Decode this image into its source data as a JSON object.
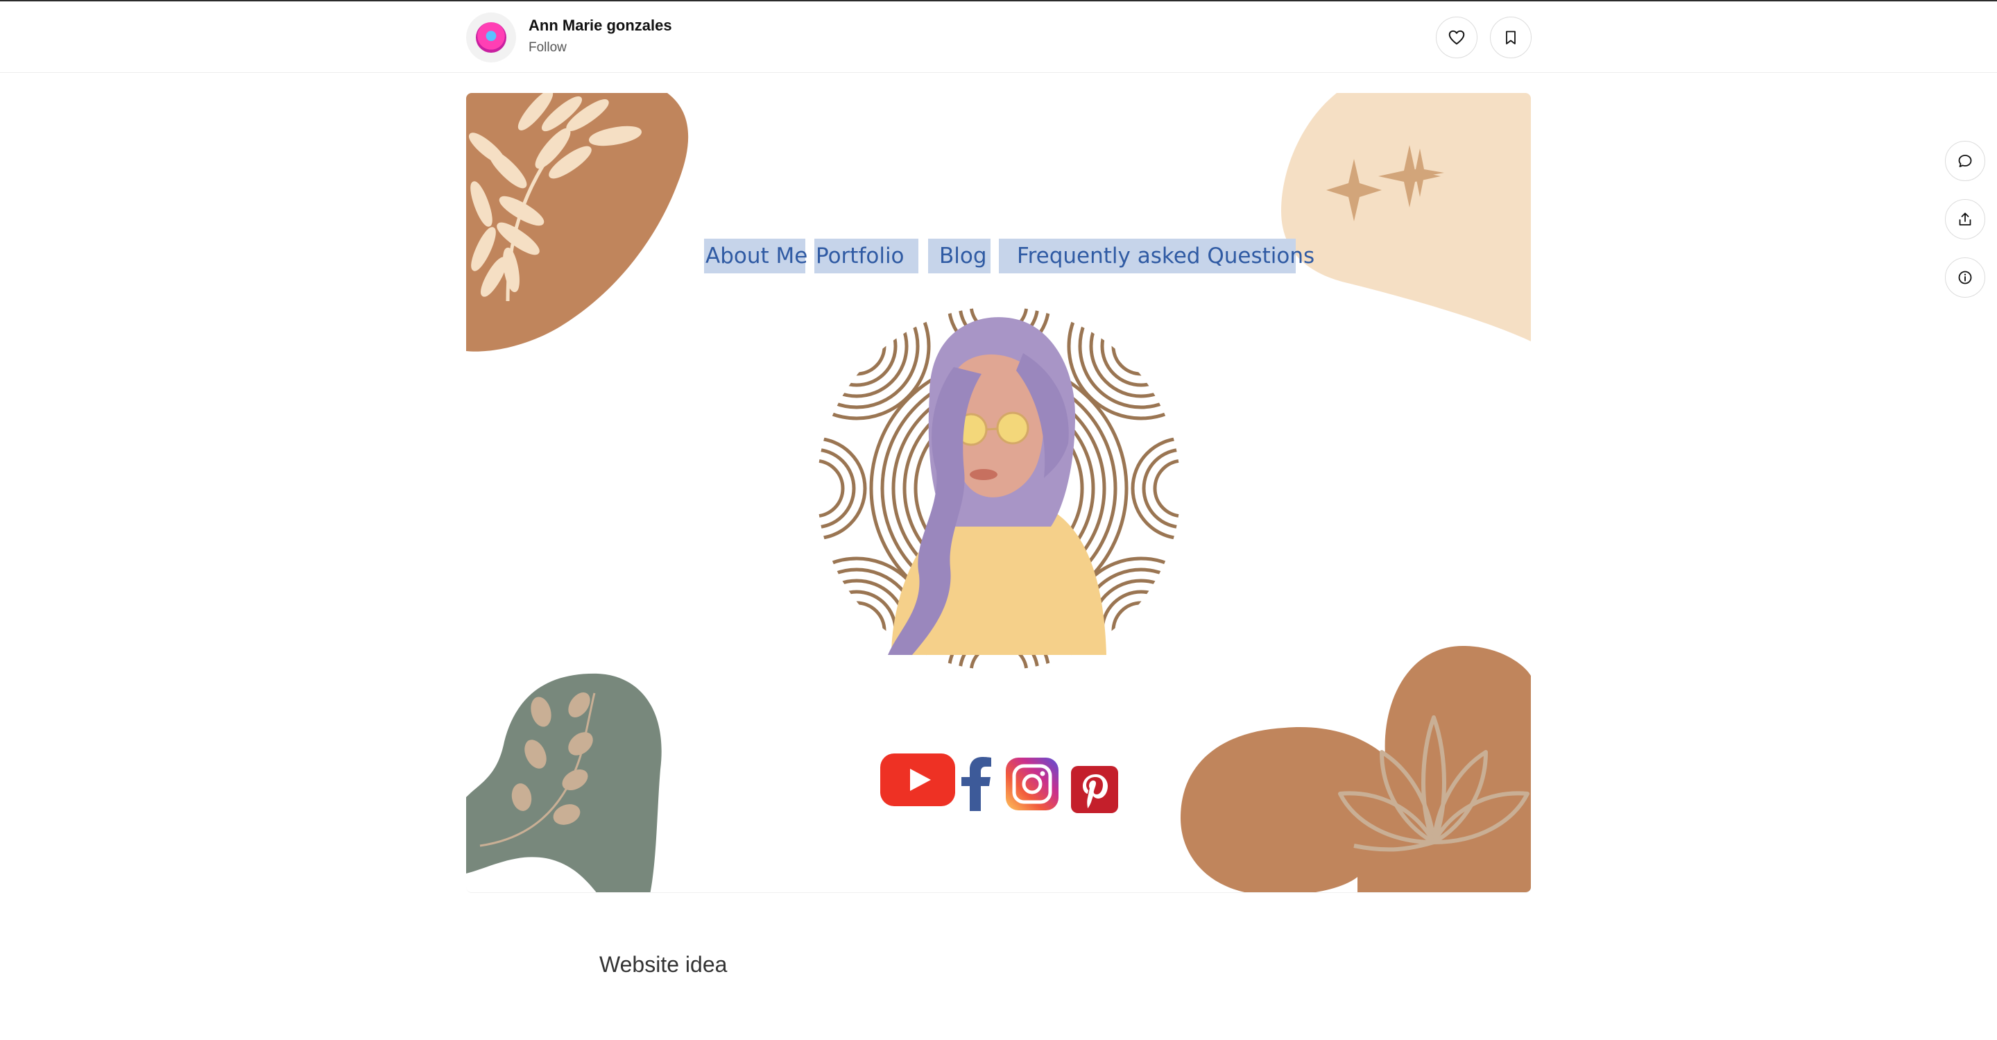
{
  "header": {
    "author_name": "Ann Marie gonzales",
    "follow_label": "Follow",
    "avatar_icon": "profile-avatar-icon",
    "like_icon": "heart-icon",
    "bookmark_icon": "bookmark-icon"
  },
  "side_actions": [
    {
      "icon": "comment-icon"
    },
    {
      "icon": "share-icon"
    },
    {
      "icon": "info-icon"
    }
  ],
  "design": {
    "nav": [
      "About Me",
      "Portfolio",
      "Blog",
      "Frequently asked Questions"
    ],
    "social_icons": [
      "youtube-icon",
      "facebook-icon",
      "instagram-icon",
      "pinterest-icon"
    ],
    "colors": {
      "terracotta": "#c0855c",
      "peach": "#f5dfc4",
      "sage": "#78887c",
      "nav_highlight": "#c6d4ea",
      "nav_text": "#2f5aa3"
    }
  },
  "caption": "Website idea"
}
